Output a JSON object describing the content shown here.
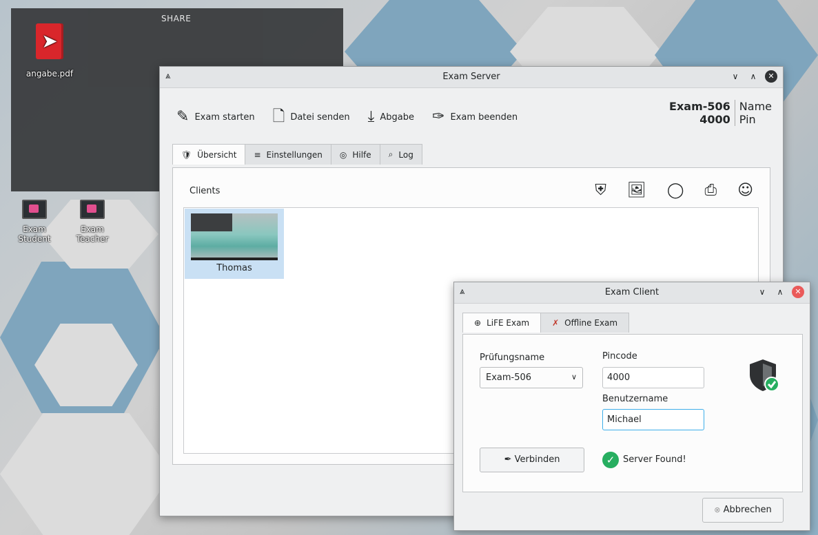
{
  "desktop": {
    "share_title": "SHARE",
    "icons": [
      {
        "label": "angabe.pdf",
        "icon": "pdf-file-icon"
      },
      {
        "label": "Exam\nStudent",
        "icon": "exam-student-icon"
      },
      {
        "label": "Exam\nTeacher",
        "icon": "exam-teacher-icon"
      }
    ]
  },
  "server_window": {
    "title": "Exam Server",
    "toolbar": {
      "start_label": "Exam starten",
      "send_label": "Datei senden",
      "collect_label": "Abgabe",
      "end_label": "Exam beenden"
    },
    "exam_info": {
      "name_value": "Exam-506",
      "pin_value": "4000",
      "name_key": "Name",
      "pin_key": "Pin"
    },
    "tabs": [
      "Übersicht",
      "Einstellungen",
      "Hilfe",
      "Log"
    ],
    "clients_label": "Clients",
    "clients": [
      {
        "name": "Thomas"
      }
    ]
  },
  "client_window": {
    "title": "Exam Client",
    "tabs": [
      "LiFE Exam",
      "Offline Exam"
    ],
    "exam_name_label": "Prüfungsname",
    "exam_name_value": "Exam-506",
    "pincode_label": "Pincode",
    "pincode_value": "4000",
    "username_label": "Benutzername",
    "username_value": "Michael",
    "connect_label": "Verbinden",
    "status_text": "Server Found!",
    "cancel_label": "Abbrechen"
  },
  "colors": {
    "accent": "#3daee9",
    "success": "#27ae60",
    "close_red": "#ea5a5a",
    "selection": "#c9e0f4"
  }
}
